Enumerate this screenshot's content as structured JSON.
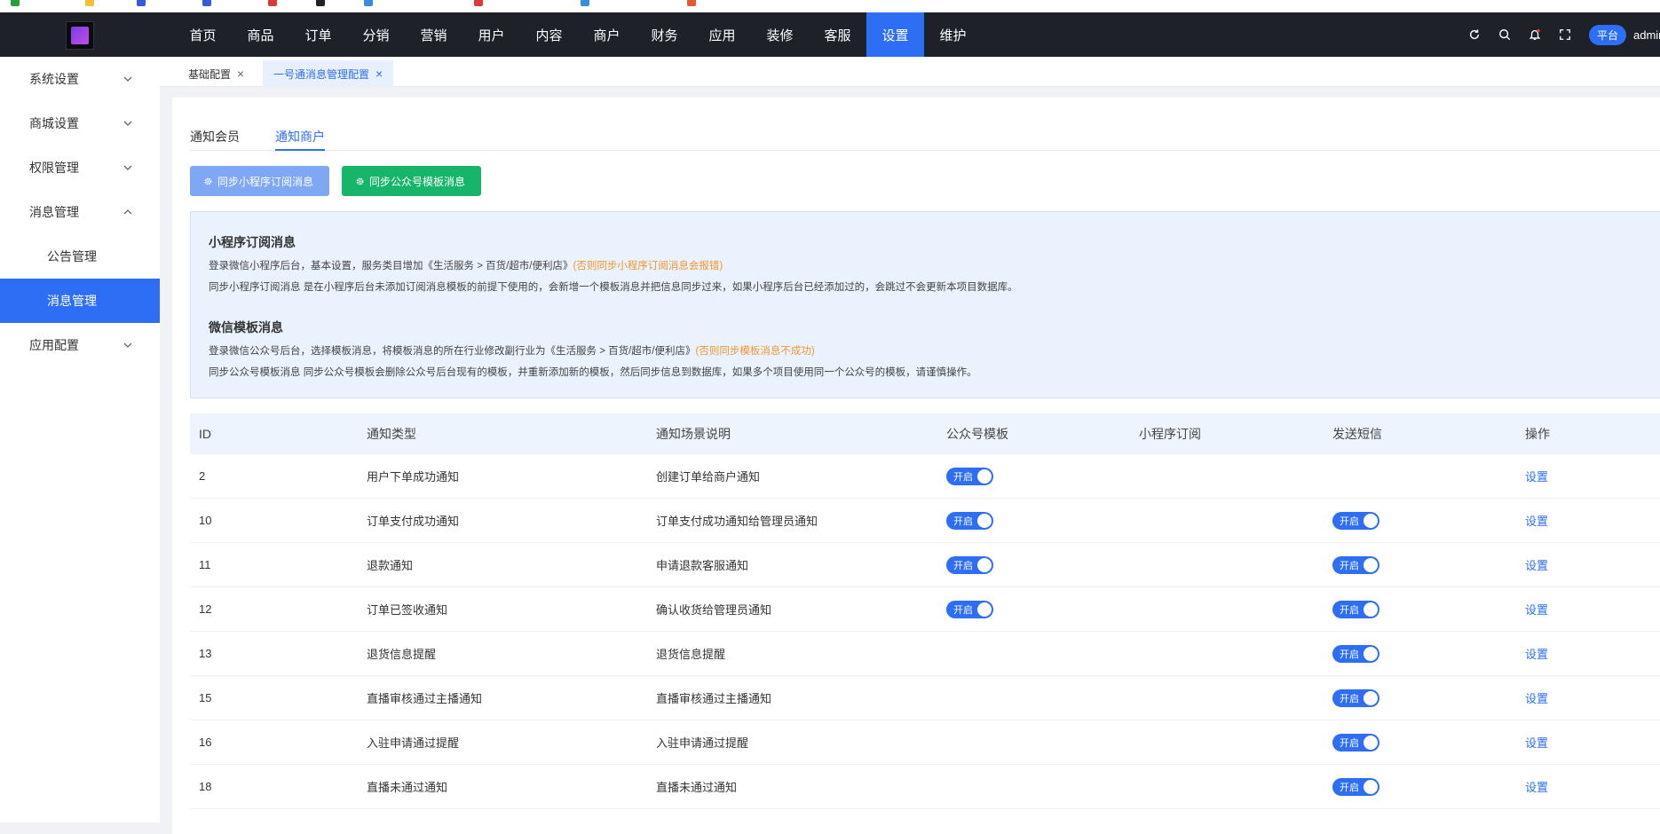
{
  "topnav": {
    "items": [
      "首页",
      "商品",
      "订单",
      "分销",
      "营销",
      "用户",
      "内容",
      "商户",
      "财务",
      "应用",
      "装修",
      "客服",
      "设置",
      "维护"
    ],
    "active_index": 12,
    "platform_label": "平台",
    "user_label": "admin"
  },
  "sidebar": {
    "items": [
      {
        "label": "系统设置",
        "expandable": true
      },
      {
        "label": "商城设置",
        "expandable": true
      },
      {
        "label": "权限管理",
        "expandable": true
      },
      {
        "label": "消息管理",
        "expandable": true,
        "expanded": true
      },
      {
        "label": "公告管理",
        "sub": true
      },
      {
        "label": "消息管理",
        "sub": true,
        "active": true
      },
      {
        "label": "应用配置",
        "expandable": true
      }
    ]
  },
  "page_tabs": [
    {
      "label": "基础配置"
    },
    {
      "label": "一号通消息管理配置",
      "active": true
    }
  ],
  "subtabs": {
    "members": "通知会员",
    "merchants": "通知商户"
  },
  "buttons": {
    "sync_mini": "同步小程序订阅消息",
    "sync_gzh": "同步公众号模板消息"
  },
  "notice": {
    "mini_title": "小程序订阅消息",
    "mini_line1": "登录微信小程序后台，基本设置，服务类目增加《生活服务 > 百货/超市/便利店》",
    "mini_line1_warn": "(否则同步小程序订阅消息会报错)",
    "mini_line2": "同步小程序订阅消息 是在小程序后台未添加订阅消息模板的前提下使用的，会新增一个模板消息并把信息同步过来，如果小程序后台已经添加过的，会跳过不会更新本项目数据库。",
    "wx_title": "微信模板消息",
    "wx_line1": "登录微信公众号后台，选择模板消息，将模板消息的所在行业修改副行业为《生活服务 > 百货/超市/便利店》",
    "wx_line1_warn": "(否则同步模板消息不成功)",
    "wx_line2": "同步公众号模板消息 同步公众号模板会删除公众号后台现有的模板，并重新添加新的模板，然后同步信息到数据库，如果多个项目使用同一个公众号的模板，请谨慎操作。"
  },
  "table": {
    "headers": [
      "ID",
      "通知类型",
      "通知场景说明",
      "公众号模板",
      "小程序订阅",
      "发送短信",
      "操作"
    ],
    "toggle_label": "开启",
    "action_label": "设置",
    "rows": [
      {
        "id": "2",
        "type": "用户下单成功通知",
        "scene": "创建订单给商户通知",
        "gzh": true,
        "mini": false,
        "sms": false
      },
      {
        "id": "10",
        "type": "订单支付成功通知",
        "scene": "订单支付成功通知给管理员通知",
        "gzh": true,
        "mini": false,
        "sms": true
      },
      {
        "id": "11",
        "type": "退款通知",
        "scene": "申请退款客服通知",
        "gzh": true,
        "mini": false,
        "sms": true
      },
      {
        "id": "12",
        "type": "订单已签收通知",
        "scene": "确认收货给管理员通知",
        "gzh": true,
        "mini": false,
        "sms": true
      },
      {
        "id": "13",
        "type": "退货信息提醒",
        "scene": "退货信息提醒",
        "gzh": false,
        "mini": false,
        "sms": true
      },
      {
        "id": "15",
        "type": "直播审核通过主播通知",
        "scene": "直播审核通过主播通知",
        "gzh": false,
        "mini": false,
        "sms": true
      },
      {
        "id": "16",
        "type": "入驻申请通过提醒",
        "scene": "入驻申请通过提醒",
        "gzh": false,
        "mini": false,
        "sms": true
      },
      {
        "id": "18",
        "type": "直播未通过通知",
        "scene": "直播未通过通知",
        "gzh": false,
        "mini": false,
        "sms": true
      }
    ]
  },
  "colors": {
    "accent": "#2d6ef5",
    "topbar": "#1e2228",
    "success": "#16b56a",
    "warn": "#f0962f"
  }
}
